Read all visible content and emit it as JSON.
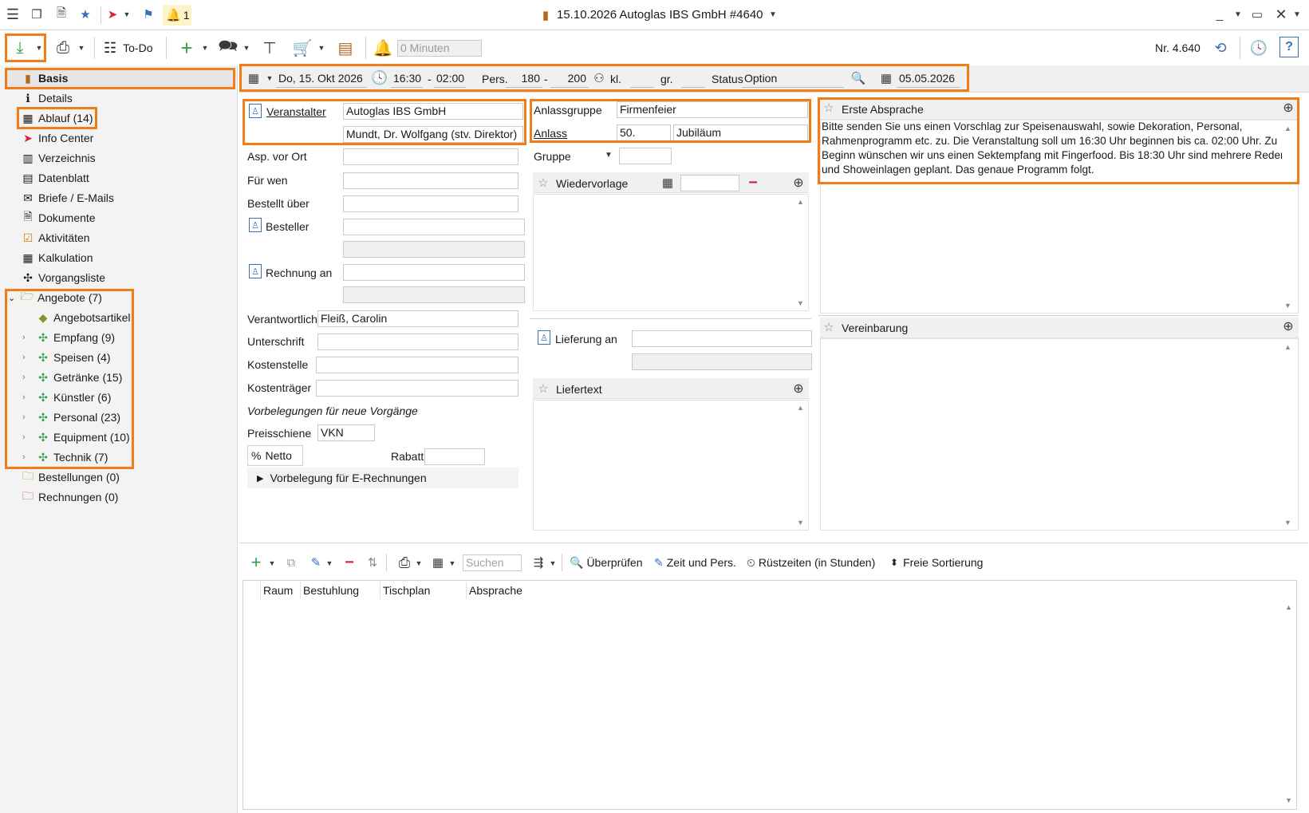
{
  "titlebar": {
    "title": "15.10.2026 Autoglas IBS GmbH  #4640",
    "notify_count": "1"
  },
  "toolbar": {
    "todo_label": "To-Do",
    "minutes_placeholder": "0 Minuten",
    "number_label": "Nr. 4.640"
  },
  "datebar": {
    "date": "Do, 15. Okt 2026",
    "time_from": "16:30",
    "dash1": "-",
    "time_to": "02:00",
    "pers_label": "Pers.",
    "pers_from": "180",
    "dash2": "-",
    "pers_to": "200",
    "kl_label": "kl.",
    "kl_value": "",
    "gr_label": "gr.",
    "gr_value": "",
    "status_label": "Status",
    "status_value": "Option",
    "option_date": "05.05.2026"
  },
  "sidebar": {
    "items": [
      {
        "label": "Basis"
      },
      {
        "label": "Details"
      },
      {
        "label": "Ablauf (14)"
      },
      {
        "label": "Info Center"
      },
      {
        "label": "Verzeichnis"
      },
      {
        "label": "Datenblatt"
      },
      {
        "label": "Briefe / E-Mails"
      },
      {
        "label": "Dokumente"
      },
      {
        "label": "Aktivitäten"
      },
      {
        "label": "Kalkulation"
      },
      {
        "label": "Vorgangsliste"
      },
      {
        "label": "Angebote (7)"
      },
      {
        "label": "Angebotsartikel"
      },
      {
        "label": "Empfang (9)"
      },
      {
        "label": "Speisen (4)"
      },
      {
        "label": "Getränke (15)"
      },
      {
        "label": "Künstler (6)"
      },
      {
        "label": "Personal (23)"
      },
      {
        "label": "Equipment (10)"
      },
      {
        "label": "Technik (7)"
      },
      {
        "label": "Bestellungen (0)"
      },
      {
        "label": "Rechnungen (0)"
      }
    ]
  },
  "form": {
    "veranstalter_label": "Veranstalter",
    "veranstalter_value": "Autoglas IBS GmbH",
    "contact_value": "Mundt, Dr. Wolfgang (stv. Direktor)",
    "asp_label": "Asp. vor Ort",
    "fuer_wen_label": "Für wen",
    "bestellt_label": "Bestellt über",
    "besteller_label": "Besteller",
    "rechnung_label": "Rechnung an",
    "verantwortlich_label": "Verantwortlich",
    "verantwortlich_value": "Fleiß, Carolin",
    "unterschrift_label": "Unterschrift",
    "kostenstelle_label": "Kostenstelle",
    "kostentraeger_label": "Kostenträger",
    "vorbelegungen_label": "Vorbelegungen für neue Vorgänge",
    "preisschiene_label": "Preisschiene",
    "preisschiene_value": "VKN",
    "netto_label": "Netto",
    "rabatt_label": "Rabatt",
    "erechnung_label": "Vorbelegung für E-Rechnungen"
  },
  "anlass": {
    "gruppe_label": "Anlassgruppe",
    "gruppe_value": "Firmenfeier",
    "anlass_label": "Anlass",
    "anlass_value": "50.",
    "anlass_value2": "Jubiläum",
    "gruppe2_label": "Gruppe"
  },
  "wiedervorlage": {
    "label": "Wiedervorlage"
  },
  "lieferung": {
    "label": "Lieferung an"
  },
  "liefertext": {
    "label": "Liefertext"
  },
  "erste_absprache": {
    "label": "Erste Absprache",
    "text": "Bitte senden Sie uns einen Vorschlag zur Speisenauswahl, sowie Dekoration, Personal, Rahmenprogramm etc. zu. Die Veranstaltung soll um 16:30 Uhr beginnen bis ca. 02:00 Uhr. Zu Beginn wünschen wir uns einen Sektempfang mit Fingerfood. Bis 18:30 Uhr sind mehrere Reden und Showeinlagen geplant. Das genaue Programm folgt."
  },
  "vereinbarung": {
    "label": "Vereinbarung"
  },
  "bottom_toolbar": {
    "search_placeholder": "Suchen",
    "check_label": "Überprüfen",
    "time_pers_label": "Zeit und Pers.",
    "ruestzeiten_label": "Rüstzeiten (in Stunden)",
    "sort_label": "Freie Sortierung"
  },
  "grid": {
    "columns": [
      "Raum",
      "Bestuhlung",
      "Tischplan",
      "Absprache"
    ]
  },
  "colors": {
    "highlight": "#f07d1a",
    "sidebar_bg": "#f3f3f3",
    "accent_red": "#d9233a"
  }
}
